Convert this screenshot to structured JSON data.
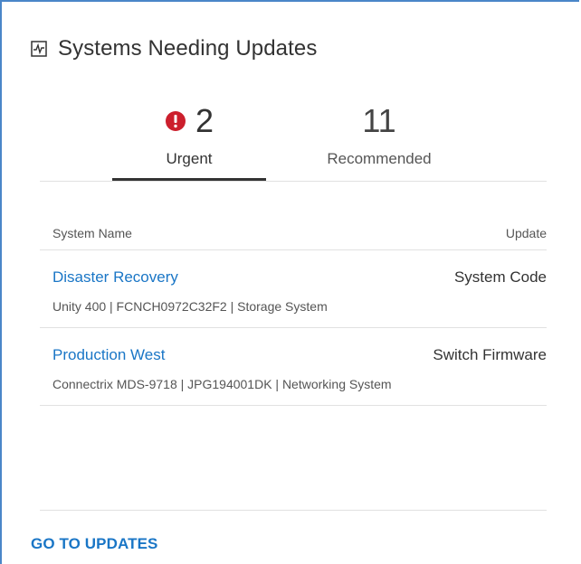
{
  "header": {
    "title": "Systems Needing Updates",
    "icon": "activity-chart-icon"
  },
  "tabs": {
    "urgent": {
      "count": "2",
      "label": "Urgent",
      "icon": "alert-circle-icon",
      "icon_color": "#cc1f2d",
      "selected": true
    },
    "recommended": {
      "count": "11",
      "label": "Recommended",
      "selected": false
    }
  },
  "table": {
    "columns": {
      "name": "System Name",
      "update": "Update"
    },
    "rows": [
      {
        "name": "Disaster Recovery",
        "update": "System Code",
        "meta": "Unity 400 | FCNCH0972C32F2 | Storage System"
      },
      {
        "name": "Production West",
        "update": "Switch Firmware",
        "meta": "Connectrix MDS-9718 | JPG194001DK | Networking System"
      }
    ]
  },
  "footer": {
    "link_label": "GO TO UPDATES"
  },
  "colors": {
    "accent": "#1a76c6",
    "border": "#4a86c8",
    "alert": "#cc1f2d"
  }
}
